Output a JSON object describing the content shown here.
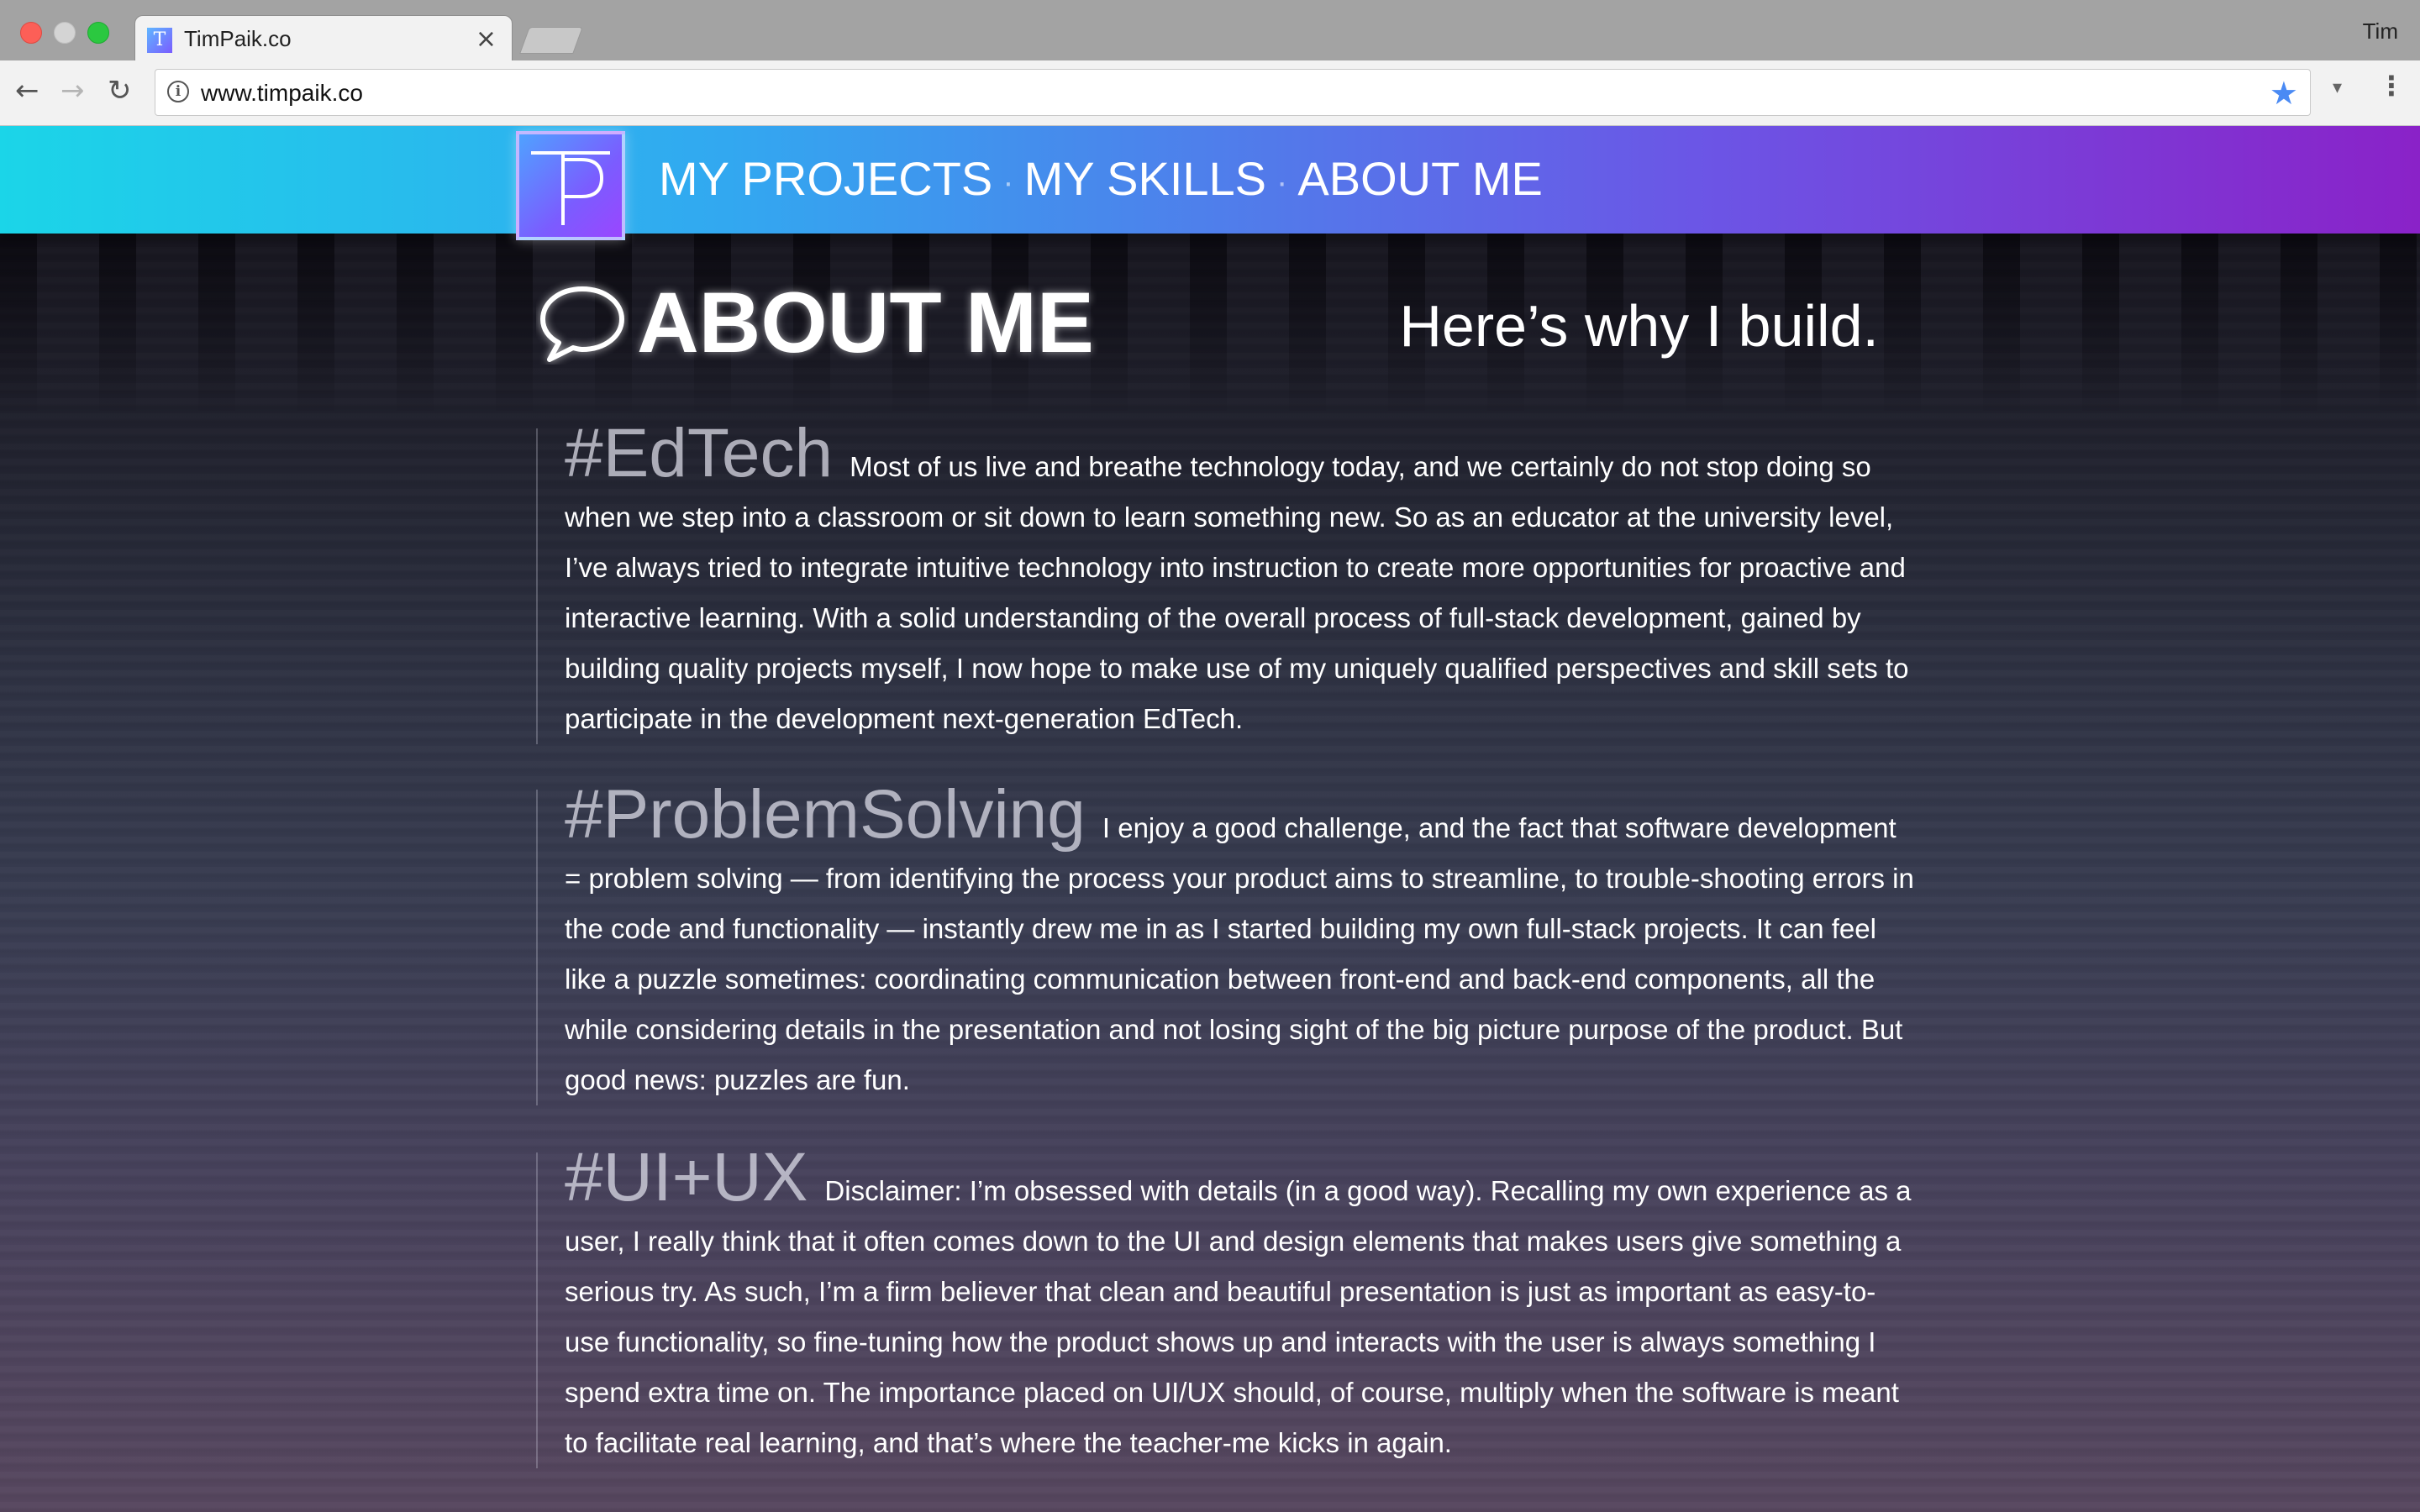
{
  "browser": {
    "tab_title": "TimPaik.co",
    "tab_close": "×",
    "profile_name": "Tim",
    "url": "www.timpaik.co",
    "icons": {
      "back": "back-arrow-icon",
      "forward": "forward-arrow-icon",
      "reload": "reload-icon",
      "site_info": "info-icon",
      "bookmark": "star-icon",
      "menu": "menu-dots-icon"
    },
    "glyphs": {
      "back": "←",
      "forward": "→",
      "reload": "↻",
      "site_info": "i",
      "bookmark": "★",
      "dropdown": "▾",
      "menu": "⋮",
      "favicon": "T"
    }
  },
  "header": {
    "logo_mark": "TP",
    "nav": [
      {
        "label": "MY PROJECTS"
      },
      {
        "label": "MY SKILLS"
      },
      {
        "label": "ABOUT ME"
      }
    ],
    "separator": "·",
    "gradient": [
      "#1bd5e8",
      "#8a22c8"
    ]
  },
  "main": {
    "title": "ABOUT ME",
    "title_icon": "speech-bubble-icon",
    "tagline": "Here’s why I build.",
    "sections": [
      {
        "heading": "#EdTech",
        "text": "Most of us live and breathe technology today, and we certainly do not stop doing so when we step into a classroom or sit down to learn something new. So as an educator at the university level, I’ve always tried to integrate intuitive technology into instruction to create more opportunities for proactive and interactive learning. With a solid understanding of the overall process of full-stack development, gained by building quality projects myself, I now hope to make use of my uniquely qualified perspectives and skill sets to participate in the development next-generation EdTech."
      },
      {
        "heading": "#ProblemSolving",
        "text": "I enjoy a good challenge, and the fact that software development = problem solving — from identifying the process your product aims to streamline, to trouble-shooting errors in the code and functionality — instantly drew me in as I started building my own full-stack projects. It can feel like a puzzle sometimes: coordinating communication between front-end and back-end components, all the while considering details in the presentation and not losing sight of the big picture purpose of the product. But good news: puzzles are fun."
      },
      {
        "heading": "#UI+UX",
        "text": "Disclaimer: I’m obsessed with details (in a good way). Recalling my own experience as a user, I really think that it often comes down to the UI and design elements that makes users give something a serious try. As such, I’m a firm believer that clean and beautiful presentation is just as important as easy-to-use functionality, so fine-tuning how the product shows up and interacts with the user is always something I spend extra time on. The importance placed on UI/UX should, of course, multiply when the software is meant to facilitate real learning, and that’s where the teacher-me kicks in again."
      }
    ]
  }
}
